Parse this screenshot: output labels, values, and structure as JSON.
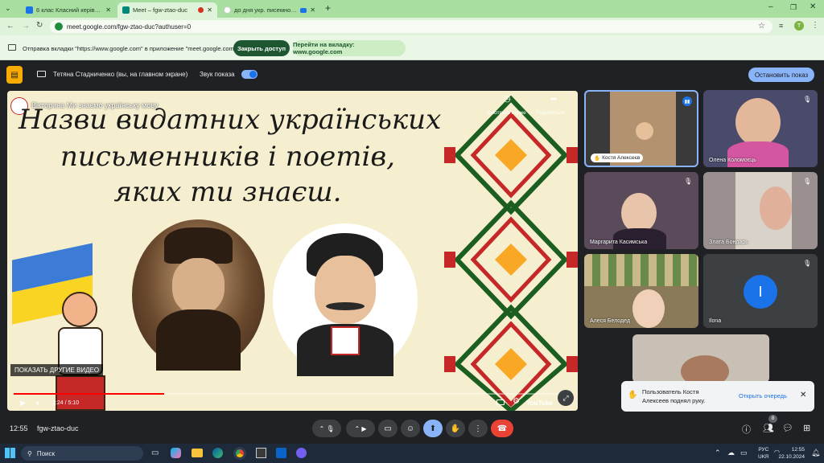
{
  "browser": {
    "tabs": [
      {
        "label": "6 клас Класний керівник Кузь",
        "active": false
      },
      {
        "label": "Meet – fgw-ztao-duc",
        "active": true
      },
      {
        "label": "до дня укр. писемності та",
        "active": false
      }
    ],
    "url": "meet.google.com/fgw-ztao-duc?authuser=0",
    "profile_initial": "Т"
  },
  "infobar": {
    "message": "Отправка вкладки \"https://www.google.com\" в приложение \"meet.google.com\"...",
    "stop_sharing": "Закрыть доступ",
    "goto_tab": "Перейти на вкладку: www.google.com"
  },
  "presenting": {
    "who": "Тетяна Стадниченко (вы, на главном экране)",
    "sound_label": "Звук показа",
    "stop_button": "Остановить показ"
  },
  "video": {
    "channel_title": "Вікторина Ми знаємо українську мову",
    "line1": "Назви видатних українських",
    "line2": "письменників і поетів,",
    "line3": "яких ти знаєш.",
    "watch_later": "Смотреть позже",
    "share": "Поделиться",
    "more_videos": "ПОКАЗАТЬ ДРУГИЕ ВИДЕО",
    "time": "1:24 / 5:10",
    "progress": 0.27,
    "youtube": "YouTube"
  },
  "participants": [
    {
      "name": "Костя Алексеєв",
      "bg": "#c9a882"
    },
    {
      "name": "Олена Коломоєць",
      "bg": "#4a4a6a"
    },
    {
      "name": "Маргарита Касимська",
      "bg": "#5a4a5a"
    },
    {
      "name": "Злата Бондарь",
      "bg": "#9a9090"
    },
    {
      "name": "Алеся Белодед",
      "bg": "#8a7a5a"
    },
    {
      "name": "Ilona",
      "initial": "I",
      "bg": "#3c4043"
    }
  ],
  "notification": {
    "text_line1": "Пользователь Костя",
    "text_line2": "Алексеев поднял руку.",
    "action": "Открыть очередь"
  },
  "bottom": {
    "time": "12:55",
    "meeting_code": "fgw-ztao-duc",
    "people_count": "8"
  },
  "taskbar": {
    "search": "Поиск",
    "lang": "РУС",
    "lang2": "UKR",
    "clock": "12:55",
    "date": "22.10.2024"
  },
  "colors": {
    "accent_green": "#1e8e3e",
    "meet_blue": "#8ab4f8",
    "end_call": "#ea4335"
  }
}
